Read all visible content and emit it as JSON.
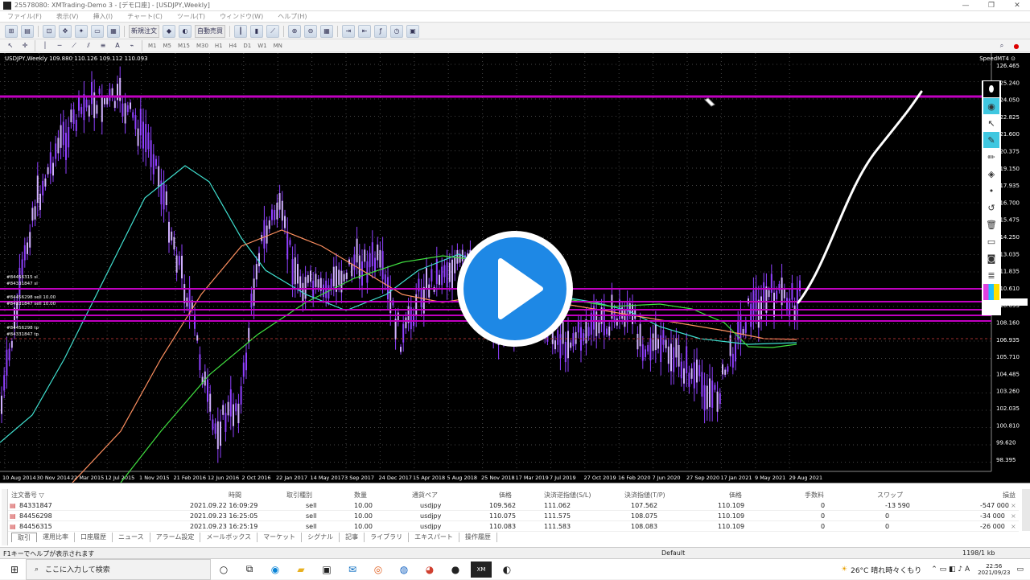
{
  "window": {
    "title": "25578080: XMTrading-Demo 3 - [デモ口座] - [USDJPY,Weekly]",
    "controls": [
      "—",
      "❐",
      "✕"
    ]
  },
  "menu": [
    "ファイル(F)",
    "表示(V)",
    "挿入(I)",
    "チャート(C)",
    "ツール(T)",
    "ウィンドウ(W)",
    "ヘルプ(H)"
  ],
  "toolbar": {
    "new_order": "新規注文",
    "autotrade": "自動売買",
    "timeframes": [
      "M1",
      "M5",
      "M15",
      "M30",
      "H1",
      "H4",
      "D1",
      "W1",
      "MN"
    ]
  },
  "chart": {
    "header": "USDJPY,Weekly  109.880 110.126 109.112 110.093",
    "corner_label": "SpeedMT4 ⊙",
    "price_labels": [
      "126.465",
      "125.240",
      "124.050",
      "122.825",
      "121.600",
      "120.375",
      "119.150",
      "117.935",
      "116.700",
      "115.475",
      "114.250",
      "113.035",
      "111.835",
      "110.610",
      "110.093",
      "108.160",
      "106.935",
      "105.710",
      "104.485",
      "103.260",
      "102.035",
      "100.810",
      "99.620",
      "98.395"
    ],
    "date_labels": [
      "10 Aug 2014",
      "30 Nov 2014",
      "22 Mar 2015",
      "12 Jul 2015",
      "1 Nov 2015",
      "21 Feb 2016",
      "12 Jun 2016",
      "2 Oct 2016",
      "22 Jan 2017",
      "14 May 2017",
      "3 Sep 2017",
      "24 Dec 2017",
      "15 Apr 2018",
      "5 Aug 2018",
      "25 Nov 2018",
      "17 Mar 2019",
      "7 Jul 2019",
      "27 Oct 2019",
      "16 Feb 2020",
      "7 Jun 2020",
      "27 Sep 2020",
      "17 Jan 2021",
      "9 May 2021",
      "29 Aug 2021"
    ],
    "order_labels": [
      "#84456315 sl",
      "#84331847 sl",
      "#84456298 sell 10.00",
      "#84331847 sell 10.00",
      "#84456298 tp",
      "#84331847 tp"
    ],
    "colors": {
      "hline": "#c000c0",
      "ma_cyan": "#40e0d0",
      "ma_green": "#40e040",
      "ma_orange": "#ff9060",
      "candle": "#9040ff",
      "play": "#1e88e5"
    }
  },
  "terminal": {
    "headers": [
      "注文番号 ▽",
      "時間",
      "取引種別",
      "数量",
      "通貨ペア",
      "価格",
      "決済逆指値(S/L)",
      "決済指値(T/P)",
      "価格",
      "手数料",
      "スワップ",
      "損益"
    ],
    "rows": [
      [
        "84331847",
        "2021.09.22 16:09:29",
        "sell",
        "10.00",
        "usdjpy",
        "109.562",
        "111.062",
        "107.562",
        "110.109",
        "0",
        "-13 590",
        "-547 000"
      ],
      [
        "84456298",
        "2021.09.23 16:25:05",
        "sell",
        "10.00",
        "usdjpy",
        "110.075",
        "111.575",
        "108.075",
        "110.109",
        "0",
        "0",
        "-34 000"
      ],
      [
        "84456315",
        "2021.09.23 16:25:19",
        "sell",
        "10.00",
        "usdjpy",
        "110.083",
        "111.583",
        "108.083",
        "110.109",
        "0",
        "0",
        "-26 000"
      ]
    ],
    "tabs": [
      "取引",
      "運用比率",
      "口座履歴",
      "ニュース",
      "アラーム設定",
      "メールボックス",
      "マーケット",
      "シグナル",
      "記事",
      "ライブラリ",
      "エキスパート",
      "操作履歴"
    ]
  },
  "status": {
    "help": "F1キーでヘルプが表示されます",
    "profile": "Default",
    "traffic": "1198/1 kb"
  },
  "taskbar": {
    "search_placeholder": "ここに入力して検索",
    "weather": "26°C  晴れ時々くもり",
    "time": "22:56",
    "date": "2021/09/23"
  }
}
